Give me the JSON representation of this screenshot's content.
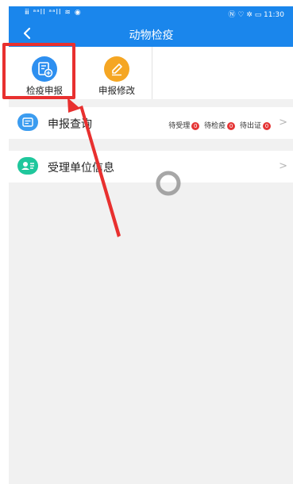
{
  "status_bar": {
    "signal_text": "ⅲ ᵃᵃll ᵃᵃll ≋ ◉",
    "right_text": "Ⓝ ♡ ✲ ▭ 11:30"
  },
  "nav": {
    "title": "动物检疫",
    "back_icon": "chevron-left-icon"
  },
  "tiles": [
    {
      "label": "检疫申报",
      "icon": "declare-doc-icon",
      "color": "#2d8ff0"
    },
    {
      "label": "申报修改",
      "icon": "pencil-icon",
      "color": "#f5a623"
    }
  ],
  "rows": {
    "query": {
      "label": "申报查询",
      "icon": "query-card-icon",
      "color": "#3b9cf0",
      "badges": [
        {
          "label": "待受理",
          "count": "0"
        },
        {
          "label": "待检疫",
          "count": "0"
        },
        {
          "label": "待出证",
          "count": "0"
        }
      ]
    },
    "unit": {
      "label": "受理单位信息",
      "icon": "contact-card-icon",
      "color": "#1fc79c"
    }
  },
  "colors": {
    "primary": "#1a86ec",
    "highlight": "#e8302f",
    "badge": "#e53535"
  }
}
